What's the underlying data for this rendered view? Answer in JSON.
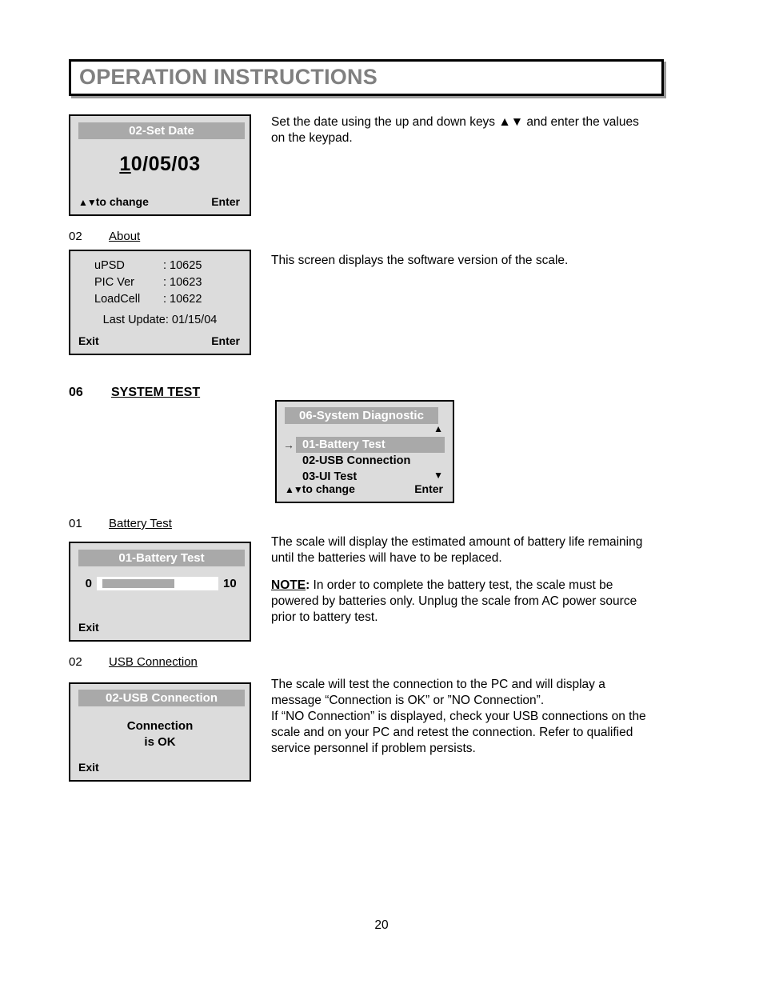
{
  "page": {
    "title": "OPERATION INSTRUCTIONS",
    "number": "20"
  },
  "colors": {
    "title_text": "#808080",
    "lcd_background": "#dcdcdc",
    "lcd_header_bar": "#a9a9a9",
    "highlight": "#a9a9a9",
    "border": "#000000"
  },
  "sections": {
    "set_date": {
      "screen": {
        "header": "02-Set Date",
        "value_underlined": "1",
        "value_rest": "0/05/03",
        "footer_left_arrows": "▲▼",
        "footer_left": "to change",
        "footer_right": "Enter"
      },
      "description": "Set the date using the up and down keys ▲▼ and enter the values on the keypad."
    },
    "about": {
      "heading_number": "02",
      "heading_label": "About",
      "screen": {
        "rows": [
          {
            "key": "uPSD",
            "value": ": 10625"
          },
          {
            "key": "PIC Ver",
            "value": ": 10623"
          },
          {
            "key": "LoadCell",
            "value": ": 10622"
          }
        ],
        "last_update": "Last Update: 01/15/04",
        "footer_left": "Exit",
        "footer_right": "Enter"
      },
      "description": "This screen displays the software version of the scale."
    },
    "system_test": {
      "heading_number": "06",
      "heading_label": "SYSTEM TEST",
      "screen": {
        "header": "06-System Diagnostic",
        "selection_pointer": "→",
        "scroll_up_icon": "▲",
        "scroll_down_icon": "▼",
        "items": [
          {
            "label": "01-Battery Test",
            "selected": true
          },
          {
            "label": "02-USB Connection",
            "selected": false
          },
          {
            "label": "03-UI Test",
            "selected": false
          }
        ],
        "footer_left_arrows": "▲▼",
        "footer_left": "to change",
        "footer_right": "Enter"
      }
    },
    "battery_test": {
      "heading_number": "01",
      "heading_label": "Battery Test",
      "screen": {
        "header": "01-Battery Test",
        "bar_min": "0",
        "bar_max": "10",
        "bar_fill_percent": 65,
        "footer_left": "Exit"
      },
      "description": "The scale will display the estimated amount of battery life remaining until the batteries will have to be replaced.",
      "note_label": "NOTE",
      "note_colon": ":",
      "note_text": " In order to complete the battery test, the scale must be powered by batteries only. Unplug the scale from AC power source prior to battery test."
    },
    "usb_connection": {
      "heading_number": "02",
      "heading_label": "USB Connection",
      "screen": {
        "header": "02-USB Connection",
        "message_line1": "Connection",
        "message_line2": "is OK",
        "footer_left": "Exit"
      },
      "description_line1": "The scale will test the connection to the PC and will display a message “Connection is OK” or ”NO Connection”.",
      "description_line2": "If “NO Connection” is displayed, check your USB connections on the scale and on your PC and retest the connection. Refer to qualified service personnel if problem persists."
    }
  }
}
